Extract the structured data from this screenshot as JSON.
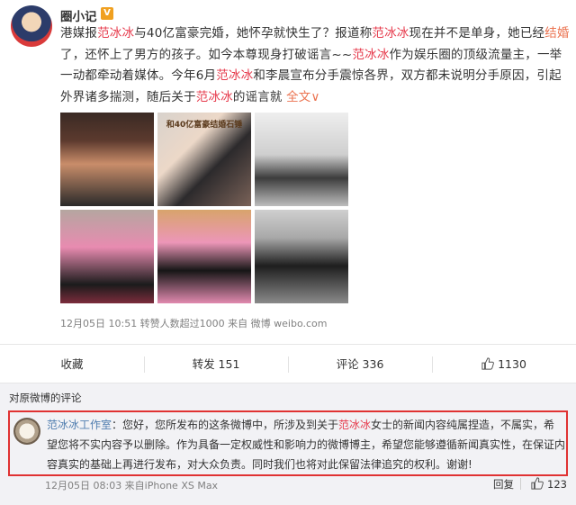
{
  "post": {
    "username": "圈小记",
    "badge": "V",
    "text": {
      "t1": "港媒报",
      "k1": "范冰冰",
      "t2": "与40亿富豪完婚，她怀孕就快生了？报道称",
      "k2": "范冰冰",
      "t3": "现在并不是单身，她已经",
      "link1": "结婚",
      "t4": "了，还怀上了男方的孩子。如今本尊现身打破谣言~~",
      "k3": "范冰冰",
      "t5": "作为娱乐圈的顶级流量主，一举一动都牵动着媒体。今年6月",
      "k4": "范冰冰",
      "t6": "和李晨宣布分手震惊各界，双方都未说明分手原因，引起外界诸多揣测，随后关于",
      "k5": "范冰冰",
      "t7": "的谣言就 ",
      "more": "全文",
      "more_arrow": "∨"
    },
    "photo_caption": "和40亿富豪结婚石锤",
    "meta": "12月05日 10:51 转赞人数超过1000 来自 微博 weibo.com"
  },
  "actions": {
    "collect": "收藏",
    "repost": "转发 151",
    "comment": "评论 336",
    "like": "1130"
  },
  "comments": {
    "header": "对原微博的评论",
    "item": {
      "author": "范冰冰工作室",
      "text_a": "：您好，您所发布的这条微博中，所涉及到关于",
      "k": "范冰冰",
      "text_b": "女士的新闻内容纯属捏造，不属实，希望您将不实内容予以删除。作为具备一定权威性和影响力的微博博主，希望您能够遵循新闻真实性，在保证内容真实的基础上再进行发布，对大众负责。同时我们也将对此保留法律追究的权利。谢谢!",
      "meta": "12月05日 08:03 来自iPhone XS Max",
      "reply": "回复",
      "likes": "123"
    }
  },
  "colors": {
    "keyword_red": "#e6394b",
    "link_orange": "#eb7350",
    "author_blue": "#507daf",
    "highlight_border": "#e03232"
  },
  "icons": [
    "verified-badge-icon",
    "thumbs-up-icon"
  ]
}
